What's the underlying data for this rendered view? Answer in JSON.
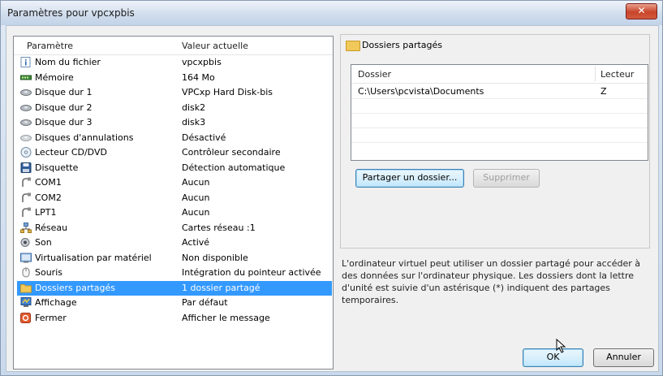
{
  "window": {
    "title": "Paramètres pour vpcxpbis",
    "close_glyph": "✕"
  },
  "list": {
    "headers": {
      "param": "Paramètre",
      "value": "Valeur actuelle"
    },
    "items": [
      {
        "label": "Nom du fichier",
        "value": "vpcxpbis",
        "icon": "info-icon",
        "selected": false
      },
      {
        "label": "Mémoire",
        "value": "164 Mo",
        "icon": "memory-icon",
        "selected": false
      },
      {
        "label": "Disque dur 1",
        "value": "VPCxp Hard Disk-bis",
        "icon": "harddisk-icon",
        "selected": false
      },
      {
        "label": "Disque dur 2",
        "value": "disk2",
        "icon": "harddisk-icon",
        "selected": false
      },
      {
        "label": "Disque dur 3",
        "value": "disk3",
        "icon": "harddisk-icon",
        "selected": false
      },
      {
        "label": "Disques d'annulations",
        "value": "Désactivé",
        "icon": "undo-disk-icon",
        "selected": false
      },
      {
        "label": "Lecteur CD/DVD",
        "value": "Contrôleur secondaire",
        "icon": "cd-icon",
        "selected": false
      },
      {
        "label": "Disquette",
        "value": "Détection automatique",
        "icon": "floppy-icon",
        "selected": false
      },
      {
        "label": "COM1",
        "value": "Aucun",
        "icon": "port-icon",
        "selected": false
      },
      {
        "label": "COM2",
        "value": "Aucun",
        "icon": "port-icon",
        "selected": false
      },
      {
        "label": "LPT1",
        "value": "Aucun",
        "icon": "port-icon",
        "selected": false
      },
      {
        "label": "Réseau",
        "value": "Cartes réseau :1",
        "icon": "network-icon",
        "selected": false
      },
      {
        "label": "Son",
        "value": "Activé",
        "icon": "sound-icon",
        "selected": false
      },
      {
        "label": "Virtualisation par matériel",
        "value": "Non disponible",
        "icon": "hardware-virtualization-icon",
        "selected": false
      },
      {
        "label": "Souris",
        "value": "Intégration du pointeur activée",
        "icon": "mouse-icon",
        "selected": false
      },
      {
        "label": "Dossiers partagés",
        "value": "1 dossier partagé",
        "icon": "folder-icon",
        "selected": true
      },
      {
        "label": "Affichage",
        "value": "Par défaut",
        "icon": "display-icon",
        "selected": false
      },
      {
        "label": "Fermer",
        "value": "Afficher le message",
        "icon": "close-setting-icon",
        "selected": false
      }
    ]
  },
  "panel": {
    "title": "Dossiers partagés",
    "grid": {
      "headers": {
        "folder": "Dossier",
        "drive": "Lecteur"
      },
      "rows": [
        {
          "folder": "C:\\Users\\pcvista\\Documents",
          "drive": "Z"
        }
      ]
    },
    "share_button": "Partager un dossier...",
    "delete_button": "Supprimer"
  },
  "info_text": "L'ordinateur virtuel peut utiliser un dossier partagé pour accéder à des données sur l'ordinateur physique. Les dossiers dont la lettre d'unité est suivie d'un astérisque (*) indiquent des partages temporaires.",
  "footer": {
    "ok": "OK",
    "cancel": "Annuler"
  },
  "colors": {
    "selection": "#3399ff",
    "close": "#c8452b",
    "folder": "#f1c95a"
  }
}
